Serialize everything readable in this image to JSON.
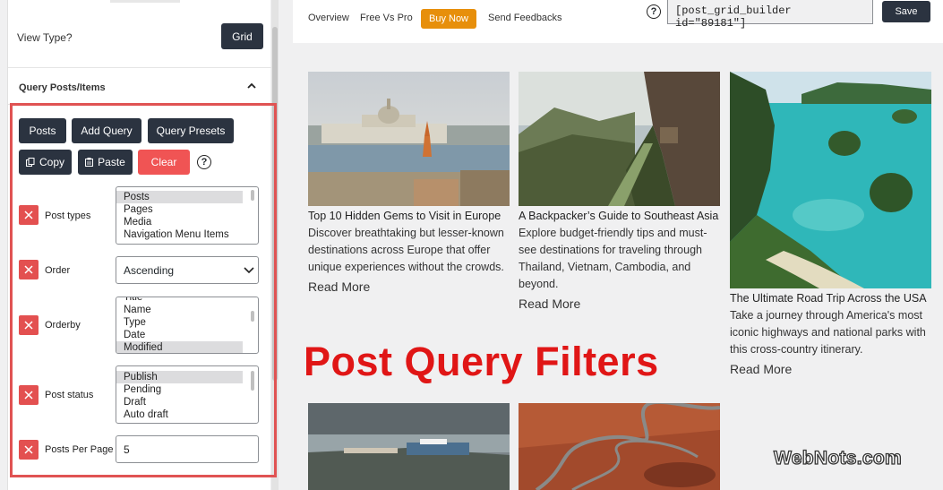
{
  "left_panel": {
    "view_type_label": "View Type?",
    "view_type_button": "Grid",
    "section_title": "Query Posts/Items",
    "buttons": {
      "posts": "Posts",
      "add_query": "Add Query",
      "query_presets": "Query Presets",
      "copy": "Copy",
      "paste": "Paste",
      "clear": "Clear"
    },
    "help_icon": "?",
    "fields": {
      "post_types": {
        "label": "Post types",
        "options": [
          "Posts",
          "Pages",
          "Media",
          "Navigation Menu Items"
        ],
        "selected": "Posts"
      },
      "order": {
        "label": "Order",
        "value": "Ascending"
      },
      "orderby": {
        "label": "Orderby",
        "partial_top": "Title",
        "options": [
          "Name",
          "Type",
          "Date",
          "Modified"
        ],
        "selected": "Modified"
      },
      "post_status": {
        "label": "Post status",
        "options": [
          "Publish",
          "Pending",
          "Draft",
          "Auto draft"
        ],
        "selected": "Publish"
      },
      "posts_per_page": {
        "label": "Posts Per Page",
        "value": "5"
      }
    }
  },
  "top_bar": {
    "nav": [
      "Overview",
      "Free Vs Pro",
      "Buy Now",
      "Send Feedbacks"
    ],
    "help_icon": "?",
    "shortcode": "[post_grid_builder id=\"89181\"]",
    "save_label": "Save"
  },
  "posts": [
    {
      "title": "Top 10 Hidden Gems to Visit in Europe",
      "excerpt": "Discover breathtaking but lesser-known destinations across Europe that offer unique experiences without the crowds.",
      "read_more": "Read More"
    },
    {
      "title": "A Backpacker’s Guide to Southeast Asia",
      "excerpt": "Explore budget-friendly tips and must-see destinations for traveling through Thailand, Vietnam, Cambodia, and beyond.",
      "read_more": "Read More"
    },
    {
      "title": "The Ultimate Road Trip Across the USA",
      "excerpt": "Take a journey through America's most iconic highways and national parks with this cross-country itinerary.",
      "read_more": "Read More"
    }
  ],
  "overlay_caption": "Post Query Filters",
  "watermark": "WebNots.com",
  "colors": {
    "dark_button": "#2b3340",
    "clear_button": "#f05454",
    "remove_button": "#e35050",
    "buy_now": "#e78f0b",
    "highlight_box": "#e05353",
    "caption": "#e01616"
  }
}
